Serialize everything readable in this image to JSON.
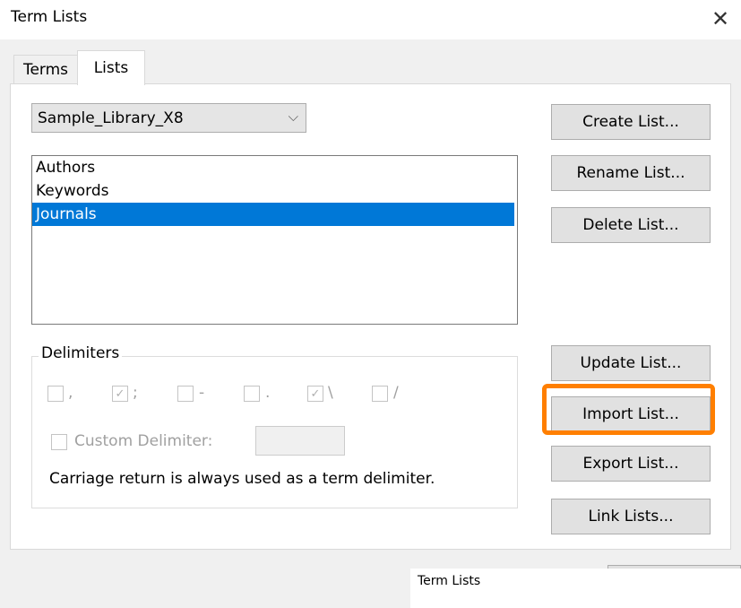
{
  "window": {
    "title": "Term Lists",
    "close_glyph": "✕"
  },
  "tabs": [
    {
      "label": "Terms"
    },
    {
      "label": "Lists"
    }
  ],
  "library_select": {
    "value": "Sample_Library_X8",
    "arrow": "⌵"
  },
  "lists": [
    {
      "label": "Authors"
    },
    {
      "label": "Keywords"
    },
    {
      "label": "Journals"
    }
  ],
  "selected_list": "Journals",
  "buttons": {
    "create": "Create List...",
    "rename": "Rename List...",
    "delete": "Delete List...",
    "update": "Update List...",
    "import": "Import List...",
    "export": "Export List...",
    "link": "Link Lists..."
  },
  "delimiters": {
    "group_label": "Delimiters",
    "items": [
      {
        "symbol": ",",
        "checked": false
      },
      {
        "symbol": ";",
        "checked": true
      },
      {
        "symbol": "-",
        "checked": false
      },
      {
        "symbol": ".",
        "checked": false
      },
      {
        "symbol": "\\",
        "checked": true
      },
      {
        "symbol": "/",
        "checked": false
      }
    ],
    "custom_label": "Custom Delimiter:",
    "custom_value": "",
    "note": "Carriage return is always used as a term delimiter."
  },
  "tooltip": {
    "text": "Term Lists"
  },
  "colors": {
    "highlight": "#ff7f00",
    "selection": "#0078d7"
  }
}
